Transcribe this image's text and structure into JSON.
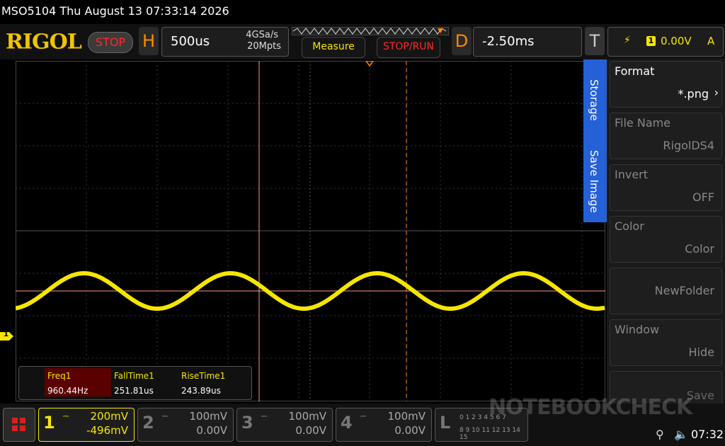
{
  "title_bar": {
    "text": "MSO5104  Thu August 13 07:33:14 2026"
  },
  "header": {
    "brand": "RIGOL",
    "run_state": "STOP",
    "horizontal": {
      "letter": "H",
      "timebase": "500us",
      "sample_rate": "4GSa/s",
      "memory": "20Mpts"
    },
    "measure_label": "Measure",
    "stoprun_label": "STOP/RUN",
    "delay": {
      "letter": "D",
      "value": "-2.50ms"
    },
    "trigger": {
      "letter": "T",
      "source_num": "1",
      "level": "0.00V",
      "mode": "A"
    }
  },
  "side_tabs": {
    "storage": "Storage",
    "save_image": "Save Image"
  },
  "menu": [
    {
      "title": "Format",
      "value": "*.png"
    },
    {
      "title": "File Name",
      "value": "RigolDS4"
    },
    {
      "title": "Invert",
      "value": "OFF"
    },
    {
      "title": "Color",
      "value": "Color"
    },
    {
      "title": "",
      "value": "NewFolder"
    },
    {
      "title": "Window",
      "value": "Hide"
    },
    {
      "title": "",
      "value": "Save"
    }
  ],
  "channel_marker": "1",
  "measurements": {
    "headers": [
      "Freq1",
      "FallTime1",
      "RiseTime1"
    ],
    "values": [
      "960.44Hz",
      "251.81us",
      "243.89us"
    ]
  },
  "channels": [
    {
      "num": "1",
      "scale": "200mV",
      "offset": "-496mV",
      "active": true
    },
    {
      "num": "2",
      "scale": "100mV",
      "offset": "0.00V",
      "active": false
    },
    {
      "num": "3",
      "scale": "100mV",
      "offset": "0.00V",
      "active": false
    },
    {
      "num": "4",
      "scale": "100mV",
      "offset": "0.00V",
      "active": false
    }
  ],
  "logic": {
    "letter": "L",
    "row1": "0 1 2 3 4 5 6 7",
    "row2": "8 9 10 11 12 13 14 15"
  },
  "status": {
    "time": "07:32"
  },
  "watermark": "NOTEBOOKCHECK",
  "colors": {
    "ch1": "#f5e600",
    "accent": "#ff8a00",
    "stop": "#ff2a2a",
    "tab": "#2660d6"
  }
}
